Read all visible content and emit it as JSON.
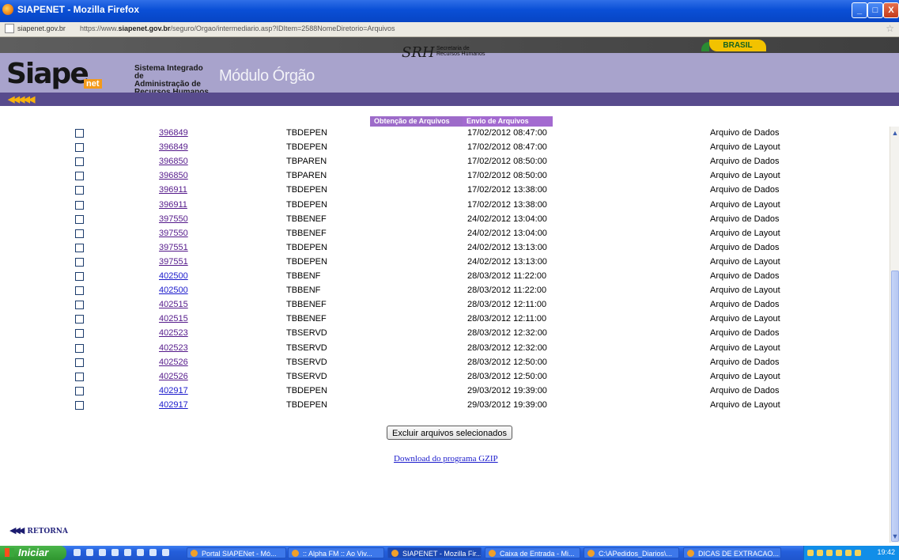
{
  "window": {
    "title": "SIAPENET - Mozilla Firefox",
    "controls": {
      "minimize": "_",
      "maximize": "□",
      "close": "X"
    }
  },
  "address_bar": {
    "domain": "siapenet.gov.br",
    "url_prefix": "https://www.",
    "url_host": "siapenet.gov.br",
    "url_path": "/seguro/Orgao/intermediario.asp?IDItem=2588NomeDiretorio=Arquivos"
  },
  "header": {
    "brasil": "BRASIL",
    "logo": "Siape",
    "logo_suffix": "net",
    "system_name_1": "Sistema Integrado de",
    "system_name_2": "Administração de",
    "system_name_3": "Recursos Humanos",
    "module": "Módulo Órgão",
    "srh": "SRH",
    "srh_text_1": "Secretaria de",
    "srh_text_2": "Recursos Humanos"
  },
  "tabs": [
    {
      "label": "Obtenção de Arquivos"
    },
    {
      "label": "Envio de Arquivos"
    }
  ],
  "files": [
    {
      "id": "396849",
      "table": "TBDEPEN",
      "date": "17/02/2012 08:47:00",
      "type": "Arquivo de Dados",
      "visited": true
    },
    {
      "id": "396849",
      "table": "TBDEPEN",
      "date": "17/02/2012 08:47:00",
      "type": "Arquivo de Layout",
      "visited": true
    },
    {
      "id": "396850",
      "table": "TBPAREN",
      "date": "17/02/2012 08:50:00",
      "type": "Arquivo de Dados",
      "visited": true
    },
    {
      "id": "396850",
      "table": "TBPAREN",
      "date": "17/02/2012 08:50:00",
      "type": "Arquivo de Layout",
      "visited": true
    },
    {
      "id": "396911",
      "table": "TBDEPEN",
      "date": "17/02/2012 13:38:00",
      "type": "Arquivo de Dados",
      "visited": true
    },
    {
      "id": "396911",
      "table": "TBDEPEN",
      "date": "17/02/2012 13:38:00",
      "type": "Arquivo de Layout",
      "visited": true
    },
    {
      "id": "397550",
      "table": "TBBENEF",
      "date": "24/02/2012 13:04:00",
      "type": "Arquivo de Dados",
      "visited": true
    },
    {
      "id": "397550",
      "table": "TBBENEF",
      "date": "24/02/2012 13:04:00",
      "type": "Arquivo de Layout",
      "visited": true
    },
    {
      "id": "397551",
      "table": "TBDEPEN",
      "date": "24/02/2012 13:13:00",
      "type": "Arquivo de Dados",
      "visited": true
    },
    {
      "id": "397551",
      "table": "TBDEPEN",
      "date": "24/02/2012 13:13:00",
      "type": "Arquivo de Layout",
      "visited": true
    },
    {
      "id": "402500",
      "table": "TBBENF",
      "date": "28/03/2012 11:22:00",
      "type": "Arquivo de Dados",
      "visited": false
    },
    {
      "id": "402500",
      "table": "TBBENF",
      "date": "28/03/2012 11:22:00",
      "type": "Arquivo de Layout",
      "visited": false
    },
    {
      "id": "402515",
      "table": "TBBENEF",
      "date": "28/03/2012 12:11:00",
      "type": "Arquivo de Dados",
      "visited": true
    },
    {
      "id": "402515",
      "table": "TBBENEF",
      "date": "28/03/2012 12:11:00",
      "type": "Arquivo de Layout",
      "visited": true
    },
    {
      "id": "402523",
      "table": "TBSERVD",
      "date": "28/03/2012 12:32:00",
      "type": "Arquivo de Dados",
      "visited": true
    },
    {
      "id": "402523",
      "table": "TBSERVD",
      "date": "28/03/2012 12:32:00",
      "type": "Arquivo de Layout",
      "visited": true
    },
    {
      "id": "402526",
      "table": "TBSERVD",
      "date": "28/03/2012 12:50:00",
      "type": "Arquivo de Dados",
      "visited": true
    },
    {
      "id": "402526",
      "table": "TBSERVD",
      "date": "28/03/2012 12:50:00",
      "type": "Arquivo de Layout",
      "visited": true
    },
    {
      "id": "402917",
      "table": "TBDEPEN",
      "date": "29/03/2012 19:39:00",
      "type": "Arquivo de Dados",
      "visited": false
    },
    {
      "id": "402917",
      "table": "TBDEPEN",
      "date": "29/03/2012 19:39:00",
      "type": "Arquivo de Layout",
      "visited": false
    }
  ],
  "actions": {
    "delete_button": "Excluir arquivos selecionados",
    "download_link": "Download do programa GZIP",
    "back_link": "RETORNA"
  },
  "taskbar": {
    "start": "Iniciar",
    "clock": "19:42",
    "tasks": [
      {
        "label": "Portal SIAPENet - Mó...",
        "active": false
      },
      {
        "label": ":: Alpha FM :: Ao Viv...",
        "active": false
      },
      {
        "label": "SIAPENET - Mozilla Fir...",
        "active": true
      },
      {
        "label": "Caixa de Entrada - Mi...",
        "active": false
      },
      {
        "label": "C:\\APedidos_Diarios\\...",
        "active": false
      },
      {
        "label": "DICAS DE EXTRACAO...",
        "active": false
      }
    ]
  }
}
